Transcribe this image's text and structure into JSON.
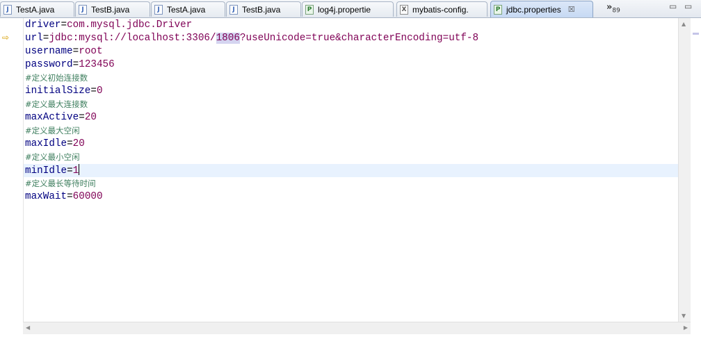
{
  "tabs": [
    {
      "label": "TestA.java",
      "icon": "java-file-icon",
      "icon_glyph": "J"
    },
    {
      "label": "TestB.java",
      "icon": "java-file-icon",
      "icon_glyph": "J"
    },
    {
      "label": "TestA.java",
      "icon": "java-file-icon",
      "icon_glyph": "J"
    },
    {
      "label": "TestB.java",
      "icon": "java-file-icon",
      "icon_glyph": "J"
    },
    {
      "label": "log4j.propertie",
      "icon": "properties-file-icon",
      "icon_glyph": "P"
    },
    {
      "label": "mybatis-config.",
      "icon": "xml-file-icon",
      "icon_glyph": "X"
    },
    {
      "label": "jdbc.properties",
      "icon": "properties-file-icon",
      "icon_glyph": "P",
      "active": true,
      "close": "☒"
    }
  ],
  "overflow": {
    "chevron": "»",
    "count": "89"
  },
  "window_controls": {
    "minimize": "▭",
    "maximize": "▭"
  },
  "editor": {
    "lines": [
      {
        "type": "prop",
        "key": "driver",
        "value": "com.mysql.jdbc.Driver"
      },
      {
        "type": "url",
        "key": "url",
        "value_before": "jdbc:mysql://localhost:3306/",
        "value_highlight": "1806",
        "value_after": "?useUnicode=true&characterEncoding=utf-8"
      },
      {
        "type": "prop",
        "key": "username",
        "value": "root"
      },
      {
        "type": "prop",
        "key": "password",
        "value": "123456"
      },
      {
        "type": "comment",
        "text": "#定义初始连接数"
      },
      {
        "type": "prop",
        "key": "initialSize",
        "value": "0"
      },
      {
        "type": "comment",
        "text": "#定义最大连接数"
      },
      {
        "type": "prop",
        "key": "maxActive",
        "value": "20"
      },
      {
        "type": "comment",
        "text": "#定义最大空闲"
      },
      {
        "type": "prop",
        "key": "maxIdle",
        "value": "20"
      },
      {
        "type": "comment",
        "text": "#定义最小空闲"
      },
      {
        "type": "prop",
        "key": "minIdle",
        "value": "1",
        "current": true
      },
      {
        "type": "comment",
        "text": "#定义最长等待时间"
      },
      {
        "type": "prop",
        "key": "maxWait",
        "value": "60000"
      }
    ],
    "equals": "=",
    "marker_glyph": "⇨"
  },
  "colors": {
    "key": "#000080",
    "value": "#2a00ff",
    "comment": "#3f7f5f",
    "current_line": "#e8f2fe",
    "highlight": "#d4d4f0"
  }
}
